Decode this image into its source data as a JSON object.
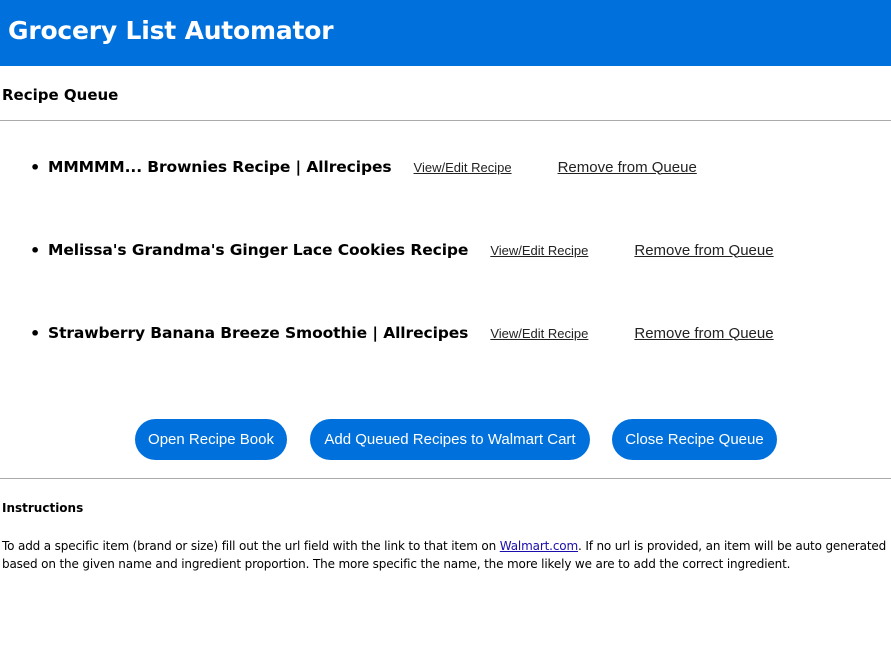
{
  "header": {
    "title": "Grocery List Automator"
  },
  "queue": {
    "title": "Recipe Queue",
    "items": [
      {
        "name": "MMMMM... Brownies Recipe | Allrecipes",
        "view_label": "View/Edit Recipe",
        "remove_label": "Remove from Queue"
      },
      {
        "name": "Melissa's Grandma's Ginger Lace Cookies Recipe",
        "view_label": "View/Edit Recipe",
        "remove_label": "Remove from Queue"
      },
      {
        "name": "Strawberry Banana Breeze Smoothie | Allrecipes",
        "view_label": "View/Edit Recipe",
        "remove_label": "Remove from Queue"
      }
    ]
  },
  "actions": {
    "open_book": "Open Recipe Book",
    "add_to_cart": "Add Queued Recipes to Walmart Cart",
    "close_queue": "Close Recipe Queue"
  },
  "instructions": {
    "title": "Instructions",
    "text_before": "To add a specific item (brand or size) fill out the url field with the link to that item on ",
    "link": "Walmart.com",
    "text_after": ". If no url is provided, an item will be auto generated based on the given name and ingredient proportion. The more specific the name, the more likely we are to add the correct ingredient."
  },
  "colors": {
    "brand": "#0071dc",
    "rule": "#aaaaaa",
    "link": "#1a0dab"
  }
}
